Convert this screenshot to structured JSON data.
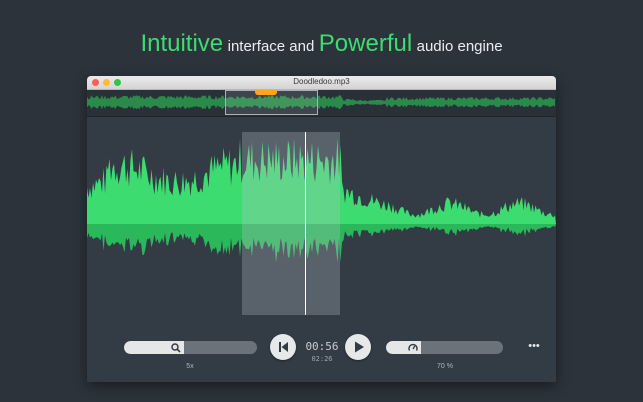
{
  "headline": {
    "highlight1": "Intuitive",
    "normal1": "interface and",
    "highlight2": "Powerful",
    "normal2": "audio engine"
  },
  "window": {
    "title": "Doodledoo.mp3"
  },
  "controls": {
    "zoom_label": "5x",
    "zoom_level": 0.45,
    "current_time": "00:56",
    "total_time": "02:26",
    "speed_label": "70 %",
    "speed_level": 0.3,
    "rewind_icon": "skip-back-icon",
    "play_icon": "play-icon",
    "zoom_icon": "magnifier-icon",
    "speed_icon": "speedometer-icon",
    "more_label": "•••"
  },
  "colors": {
    "waveform": "#3ddc70",
    "accent": "#3ddc70",
    "marker": "#ffa51c",
    "background": "#2c333b"
  }
}
